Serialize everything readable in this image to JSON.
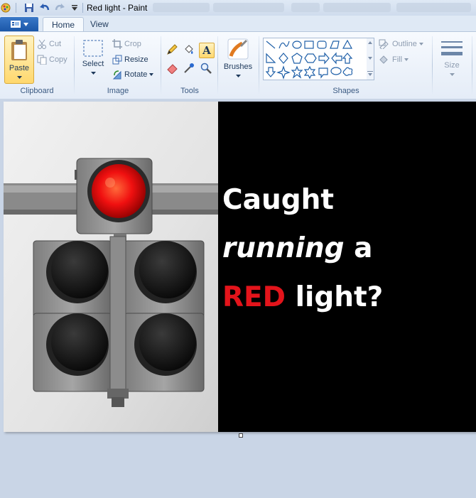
{
  "window": {
    "title": "Red light - Paint"
  },
  "tabs": {
    "home": "Home",
    "view": "View"
  },
  "clipboard": {
    "paste": "Paste",
    "cut": "Cut",
    "copy": "Copy",
    "label": "Clipboard"
  },
  "image": {
    "select": "Select",
    "crop": "Crop",
    "resize": "Resize",
    "rotate": "Rotate",
    "label": "Image"
  },
  "tools": {
    "label": "Tools"
  },
  "brushes": {
    "label": "Brushes"
  },
  "shapes": {
    "label": "Shapes",
    "outline": "Outline",
    "fill": "Fill"
  },
  "size": {
    "label": "Size"
  },
  "canvas_text": {
    "line1": "Caught",
    "line2_italic": "running",
    "line2_rest": " a",
    "line3_red": "RED",
    "line3_rest": " light?"
  },
  "icons": [
    "save-icon",
    "undo-icon",
    "redo-icon",
    "customize-icon",
    "paste-icon",
    "cut-icon",
    "copy-icon",
    "select-icon",
    "crop-icon",
    "resize-icon",
    "rotate-icon",
    "pencil-icon",
    "fill-icon",
    "text-icon",
    "eraser-icon",
    "color-picker-icon",
    "magnifier-icon",
    "brushes-icon",
    "outline-icon",
    "fill-shape-icon",
    "size-icon"
  ],
  "colors": {
    "red_text": "#e3141b",
    "canvas_bg": "#000000",
    "text_white": "#ffffff",
    "ribbon_bg": "#e4ecf7"
  }
}
